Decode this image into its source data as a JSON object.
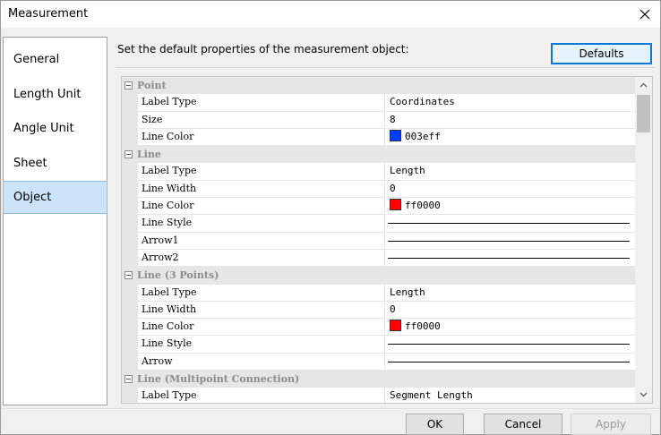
{
  "window": {
    "title": "Measurement"
  },
  "sidebar": {
    "items": [
      {
        "label": "General"
      },
      {
        "label": "Length Unit"
      },
      {
        "label": "Angle Unit"
      },
      {
        "label": "Sheet"
      },
      {
        "label": "Object",
        "selected": true
      }
    ]
  },
  "main": {
    "instructions": "Set the default properties of the measurement object:",
    "defaults_label": "Defaults"
  },
  "property_grid": {
    "rows": [
      {
        "type": "category",
        "label": "Point"
      },
      {
        "type": "property",
        "name": "Label Type",
        "value": "Coordinates"
      },
      {
        "type": "property",
        "name": "Size",
        "value": "8"
      },
      {
        "type": "property",
        "name": "Line Color",
        "value": "003eff",
        "color": "#003eff"
      },
      {
        "type": "category",
        "label": "Line"
      },
      {
        "type": "property",
        "name": "Label Type",
        "value": "Length"
      },
      {
        "type": "property",
        "name": "Line Width",
        "value": "0"
      },
      {
        "type": "property",
        "name": "Line Color",
        "value": "ff0000",
        "color": "#ff0000"
      },
      {
        "type": "property",
        "name": "Line Style",
        "line": true
      },
      {
        "type": "property",
        "name": "Arrow1",
        "line": true
      },
      {
        "type": "property",
        "name": "Arrow2",
        "line": true
      },
      {
        "type": "category",
        "label": "Line (3 Points)"
      },
      {
        "type": "property",
        "name": "Label Type",
        "value": "Length"
      },
      {
        "type": "property",
        "name": "Line Width",
        "value": "0"
      },
      {
        "type": "property",
        "name": "Line Color",
        "value": "ff0000",
        "color": "#ff0000"
      },
      {
        "type": "property",
        "name": "Line Style",
        "line": true
      },
      {
        "type": "property",
        "name": "Arrow",
        "line": true
      },
      {
        "type": "category",
        "label": "Line (Multipoint Connection)"
      },
      {
        "type": "property",
        "name": "Label Type",
        "value": "Segment Length"
      }
    ]
  },
  "footer": {
    "ok_label": "OK",
    "cancel_label": "Cancel",
    "apply_label": "Apply"
  },
  "colors": {
    "accent": "#0078d7",
    "selection": "#cce4f7",
    "category_bg": "#e6e6e6"
  }
}
